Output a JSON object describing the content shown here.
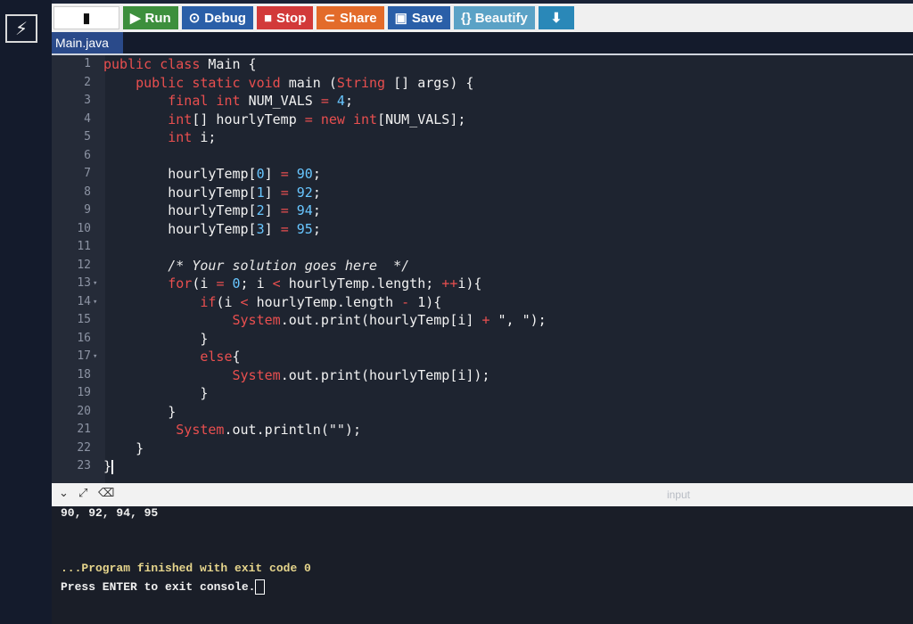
{
  "toolbar": {
    "run_label": "Run",
    "debug_label": "Debug",
    "stop_label": "Stop",
    "share_label": "Share",
    "save_label": "Save",
    "beautify_label": "{} Beautify"
  },
  "file_tab": {
    "name": "Main.java"
  },
  "editor": {
    "lines": [
      {
        "n": "1",
        "fold": ""
      },
      {
        "n": "2",
        "fold": ""
      },
      {
        "n": "3",
        "fold": ""
      },
      {
        "n": "4",
        "fold": ""
      },
      {
        "n": "5",
        "fold": ""
      },
      {
        "n": "6",
        "fold": ""
      },
      {
        "n": "7",
        "fold": ""
      },
      {
        "n": "8",
        "fold": ""
      },
      {
        "n": "9",
        "fold": ""
      },
      {
        "n": "10",
        "fold": ""
      },
      {
        "n": "11",
        "fold": ""
      },
      {
        "n": "12",
        "fold": ""
      },
      {
        "n": "13",
        "fold": "▾"
      },
      {
        "n": "14",
        "fold": "▾"
      },
      {
        "n": "15",
        "fold": ""
      },
      {
        "n": "16",
        "fold": ""
      },
      {
        "n": "17",
        "fold": "▾"
      },
      {
        "n": "18",
        "fold": ""
      },
      {
        "n": "19",
        "fold": ""
      },
      {
        "n": "20",
        "fold": ""
      },
      {
        "n": "21",
        "fold": ""
      },
      {
        "n": "22",
        "fold": ""
      },
      {
        "n": "23",
        "fold": ""
      }
    ],
    "code": {
      "l1_kw": "public class ",
      "l1_name": "Main {",
      "l2_kw": "public static void ",
      "l2_main": "main (",
      "l2_type": "String",
      "l2_rest": " [] args) {",
      "l3_kw": "final int ",
      "l3_name": "NUM_VALS ",
      "l3_eq": "= ",
      "l3_val": "4",
      "l3_end": ";",
      "l4_type": "int",
      "l4_a": "[] hourlyTemp ",
      "l4_eq": "= ",
      "l4_new": "new int",
      "l4_b": "[NUM_VALS];",
      "l5_type": "int ",
      "l5_b": "i;",
      "l7_a": "hourlyTemp[",
      "l7_i": "0",
      "l7_b": "] ",
      "l7_eq": "= ",
      "l7_v": "90",
      "l7_e": ";",
      "l8_a": "hourlyTemp[",
      "l8_i": "1",
      "l8_b": "] ",
      "l8_eq": "= ",
      "l8_v": "92",
      "l8_e": ";",
      "l9_a": "hourlyTemp[",
      "l9_i": "2",
      "l9_b": "] ",
      "l9_eq": "= ",
      "l9_v": "94",
      "l9_e": ";",
      "l10_a": "hourlyTemp[",
      "l10_i": "3",
      "l10_b": "] ",
      "l10_eq": "= ",
      "l10_v": "95",
      "l10_e": ";",
      "l12_cm": "/* Your solution goes here  */",
      "l13_kw": "for",
      "l13_a": "(i ",
      "l13_eq": "= ",
      "l13_v": "0",
      "l13_b": "; i ",
      "l13_lt": "< ",
      "l13_c": "hourlyTemp.length; ",
      "l13_pp": "++",
      "l13_d": "i){",
      "l14_kw": "if",
      "l14_a": "(i ",
      "l14_lt": "< ",
      "l14_b": "hourlyTemp.length ",
      "l14_m": "- ",
      "l14_c": "1){",
      "l15_sys": "System",
      "l15_a": ".out.print(hourlyTemp[i] ",
      "l15_p": "+ ",
      "l15_s": "\", \"",
      "l15_e": ");",
      "l16": "}",
      "l17_kw": "else",
      "l17_b": "{",
      "l18_sys": "System",
      "l18_a": ".out.print(hourlyTemp[i]);",
      "l19": "}",
      "l20": "}",
      "l21_sys": "System",
      "l21_a": ".out.println(\"\");",
      "l22": "}",
      "l23": "}"
    }
  },
  "console": {
    "input_label": "input",
    "output": "90, 92, 94, 95",
    "finished": "...Program finished with exit code 0",
    "press_enter": "Press ENTER to exit console."
  }
}
